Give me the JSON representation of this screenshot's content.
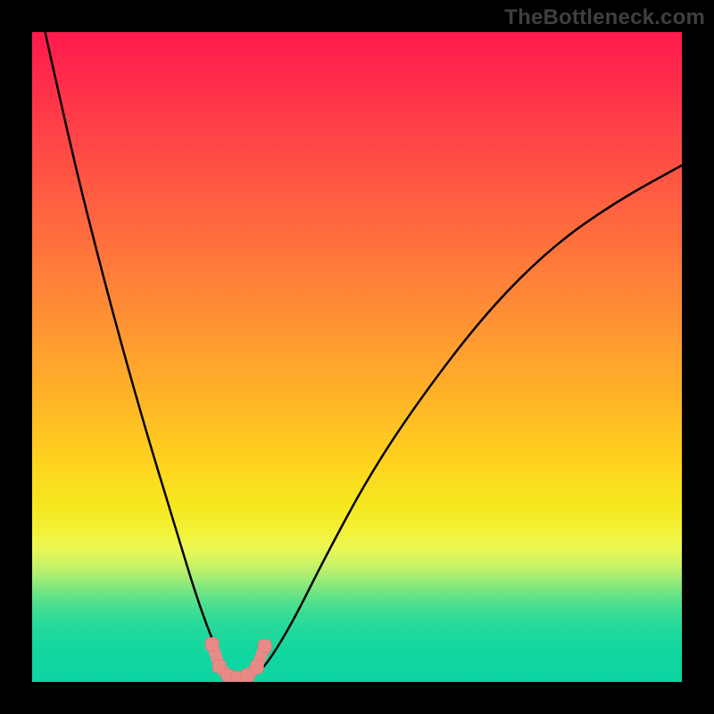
{
  "watermark": "TheBottleneck.com",
  "colors": {
    "frame": "#000000",
    "curve": "#000000",
    "marker_fill": "#e98a87",
    "marker_stroke": "#d87673",
    "gradient_top": "#ff1a4d",
    "gradient_bottom": "#0dd5a2"
  },
  "chart_data": {
    "type": "line",
    "title": "",
    "xlabel": "",
    "ylabel": "",
    "xlim": [
      0,
      100
    ],
    "ylim": [
      0,
      100
    ],
    "grid": false,
    "legend": false,
    "series": [
      {
        "name": "bottleneck-curve",
        "x": [
          2,
          6,
          10,
          14,
          18,
          22,
          25,
          27.5,
          29.5,
          31,
          32.5,
          34,
          36,
          40,
          45,
          52,
          60,
          70,
          80,
          90,
          100
        ],
        "y": [
          100,
          82,
          66,
          51,
          37,
          24,
          14,
          7,
          2.5,
          0.8,
          0.6,
          0.9,
          2.5,
          9,
          19,
          32,
          44,
          57,
          67,
          74,
          79.5
        ]
      }
    ],
    "markers": {
      "name": "valley-markers",
      "x": [
        27.7,
        28.8,
        30.2,
        31.6,
        33.2,
        34.6,
        35.8
      ],
      "y": [
        5.8,
        2.4,
        0.9,
        0.6,
        1.0,
        2.3,
        5.5
      ]
    },
    "annotations": []
  }
}
